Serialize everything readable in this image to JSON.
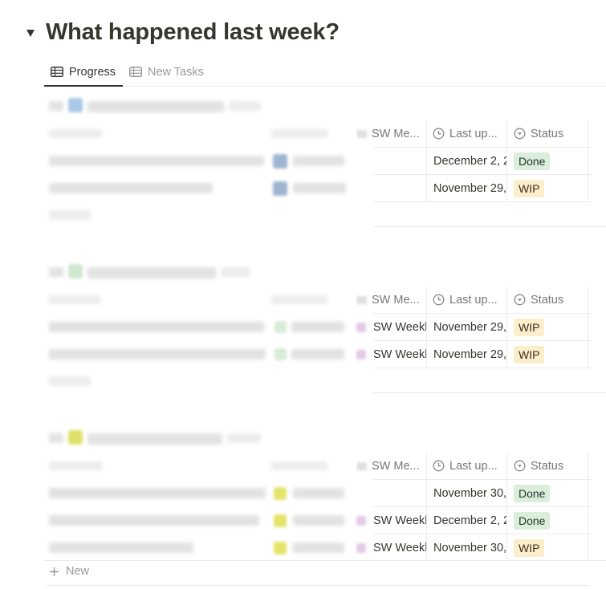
{
  "page": {
    "title": "What happened last week?"
  },
  "tabs": [
    {
      "label": "Progress",
      "icon": "table-icon",
      "active": true
    },
    {
      "label": "New Tasks",
      "icon": "table-icon",
      "active": false
    }
  ],
  "columns": {
    "meeting": "SW Me...",
    "last_updated": "Last up...",
    "status": "Status"
  },
  "groups": [
    {
      "rows": [
        {
          "meeting": "",
          "last_updated": "December 2, 2",
          "status": "Done"
        },
        {
          "meeting": "",
          "last_updated": "November 29,",
          "status": "WIP"
        }
      ]
    },
    {
      "rows": [
        {
          "meeting": "SW Weekl",
          "last_updated": "November 29,",
          "status": "WIP"
        },
        {
          "meeting": "SW Weekl",
          "last_updated": "November 29,",
          "status": "WIP"
        }
      ]
    },
    {
      "rows": [
        {
          "meeting": "",
          "last_updated": "November 30,",
          "status": "Done"
        },
        {
          "meeting": "SW Weekl",
          "last_updated": "December 2, 2",
          "status": "Done"
        },
        {
          "meeting": "SW Weekl",
          "last_updated": "November 30,",
          "status": "WIP"
        }
      ]
    }
  ],
  "new_row_label": "New",
  "colors": {
    "done_bg": "#dbeddb",
    "wip_bg": "#fbeecb",
    "text": "#37352f",
    "muted": "#787774",
    "border": "#ebebea"
  }
}
